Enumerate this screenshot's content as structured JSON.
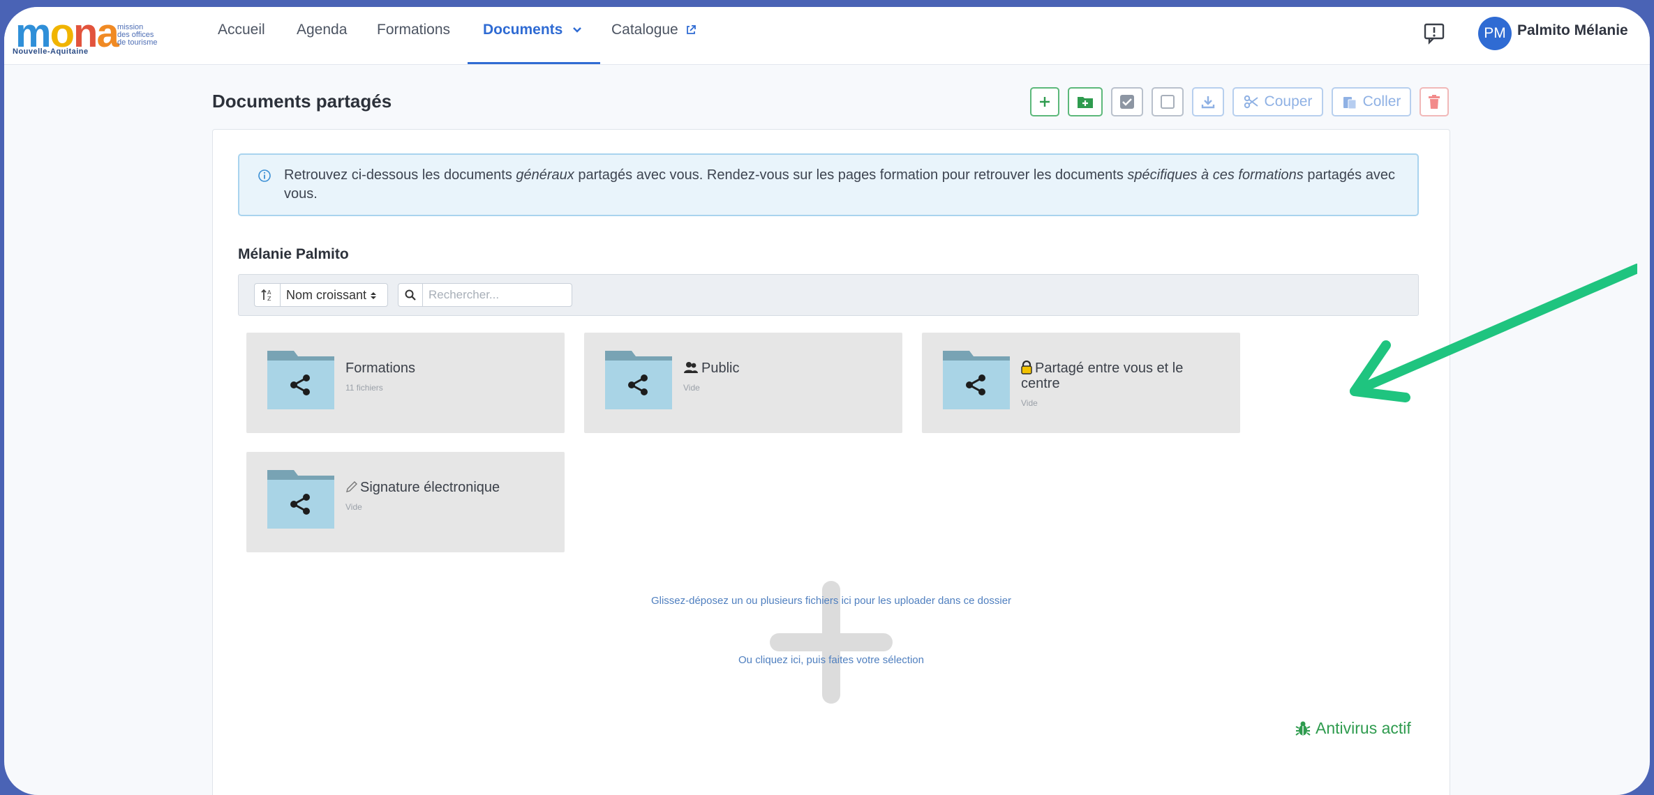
{
  "brand": {
    "logo_word": [
      "m",
      "o",
      "n",
      "a"
    ],
    "logo_subtitle": "Nouvelle-Aquitaine",
    "logo_tagline": [
      "mission",
      "des offices",
      "de tourisme"
    ],
    "colors": {
      "blue": "#2f8fd8",
      "yellow": "#f0b400",
      "red": "#e2533c",
      "orange": "#f08a24"
    }
  },
  "nav": {
    "items": [
      {
        "label": "Accueil"
      },
      {
        "label": "Agenda"
      },
      {
        "label": "Formations"
      },
      {
        "label": "Documents"
      },
      {
        "label": "Catalogue"
      }
    ],
    "active_index": 3,
    "active_color": "#2f6bd3"
  },
  "user": {
    "initials": "PM",
    "name": "Palmito Mélanie"
  },
  "page": {
    "title": "Documents partagés",
    "toolbar": {
      "buttons": [
        {
          "icon": "plus-icon"
        },
        {
          "icon": "folder-plus-icon"
        },
        {
          "icon": "check-square-icon"
        },
        {
          "icon": "empty-square-icon"
        },
        {
          "icon": "download-icon"
        },
        {
          "icon": "scissors-icon",
          "label": "Couper"
        },
        {
          "icon": "paste-icon",
          "label": "Coller"
        },
        {
          "icon": "trash-icon"
        }
      ]
    }
  },
  "info": {
    "p1": "Retrouvez ci-dessous les documents ",
    "em1": "généraux",
    "p2": " partagés avec vous. Rendez-vous sur les pages formation pour retrouver les documents ",
    "em2": "spécifiques à ces formations",
    "p3": " partagés avec vous."
  },
  "section": {
    "owner": "Mélanie Palmito"
  },
  "filters": {
    "sort_label": "Nom croissant",
    "search_placeholder": "Rechercher..."
  },
  "folders": [
    {
      "name": "Formations",
      "meta": "11 fichiers",
      "badge": ""
    },
    {
      "name": "Public",
      "meta": "Vide",
      "badge": "users-icon"
    },
    {
      "name": "Partagé entre vous et le centre",
      "meta": "Vide",
      "badge": "lock-icon"
    },
    {
      "name": "Signature électronique",
      "meta": "Vide",
      "badge": "pen-icon"
    }
  ],
  "dropzone": {
    "line1": "Glissez-déposez un ou plusieurs fichiers ici pour les uploader dans ce dossier",
    "line2": "Ou cliquez ici, puis faites votre sélection"
  },
  "antivirus": {
    "label": "Antivirus actif"
  },
  "annotation": {
    "arrow_color": "#1fc47f"
  }
}
